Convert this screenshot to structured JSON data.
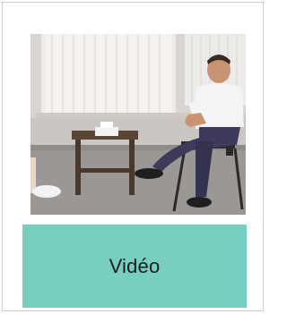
{
  "card": {
    "label": "Vidéo",
    "thumbnail_icon": "video-thumbnail",
    "colors": {
      "button_bg": "#78cebf",
      "button_text": "#1c1c1c",
      "border": "#cfcfcf"
    }
  }
}
